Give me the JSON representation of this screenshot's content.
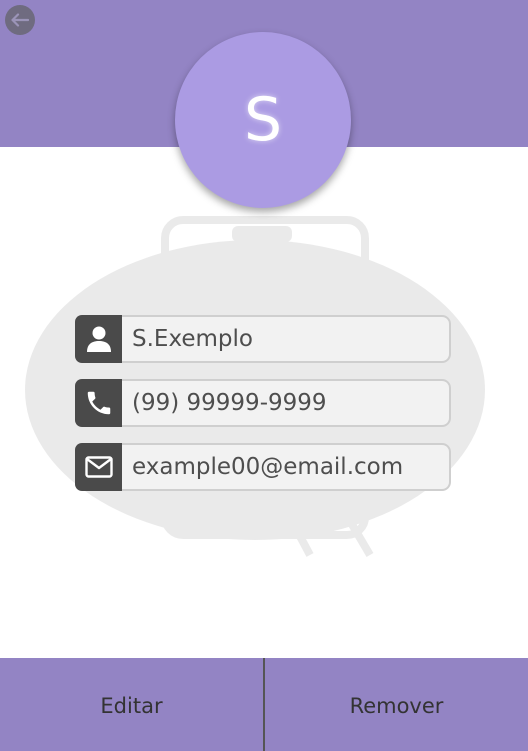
{
  "header": {
    "back_icon": "arrow-left-icon",
    "color": "#9384c4"
  },
  "avatar": {
    "initial": "S",
    "color": "#ab9be3"
  },
  "form": {
    "name": {
      "value": "S.Exemplo",
      "icon": "user-icon"
    },
    "phone": {
      "value": "(99) 99999-9999",
      "icon": "phone-icon"
    },
    "email": {
      "value": "example00@email.com",
      "icon": "mail-icon"
    }
  },
  "footer": {
    "edit_label": "Editar",
    "remove_label": "Remover"
  }
}
